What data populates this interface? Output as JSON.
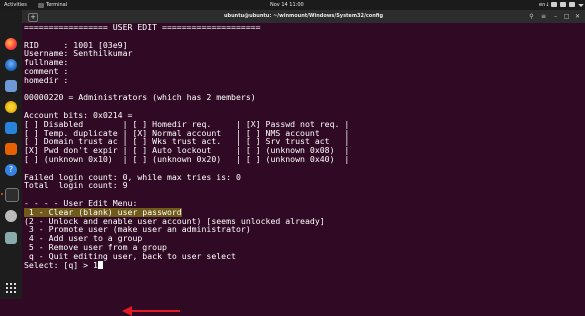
{
  "topbar": {
    "activities": "Activities",
    "app_name": "Terminal",
    "clock": "Nov 14  11:00",
    "lang": "en↓"
  },
  "terminal": {
    "title": "ubuntu@ubuntu: ~/winmount/Windows/System32/config",
    "lines": [
      "================= USER EDIT ====================",
      "",
      "RID     : 1001 [03e9]",
      "Username: Senthilkumar",
      "fullname:",
      "comment :",
      "homedir :",
      "",
      "00000220 = Administrators (which has 2 members)",
      "",
      "Account bits: 0x0214 =",
      "[ ] Disabled        | [ ] Homedir req.     | [X] Passwd not req. |",
      "[ ] Temp. duplicate | [X] Normal account   | [ ] NMS account     |",
      "[ ] Domain trust ac | [ ] Wks trust act.   | [ ] Srv trust act   |",
      "[X] Pwd don't expir | [ ] Auto lockout     | [ ] (unknown 0x08)  |",
      "[ ] (unknown 0x10)  | [ ] (unknown 0x20)   | [ ] (unknown 0x40)  |",
      "",
      "Failed login count: 0, while max tries is: 0",
      "Total  login count: 9",
      "",
      "- - - - User Edit Menu:",
      " 1 - Clear (blank) user password",
      "(2 - Unlock and enable user account) [seems unlocked already]",
      " 3 - Promote user (make user an administrator)",
      " 4 - Add user to a group",
      " 5 - Remove user from a group",
      " q - Quit editing user, back to user select",
      "Select: [q] > 1"
    ]
  },
  "colors": {
    "terminal_bg": "#300a24",
    "highlight": "#6f5a1a",
    "annotation": "#e01b24"
  }
}
